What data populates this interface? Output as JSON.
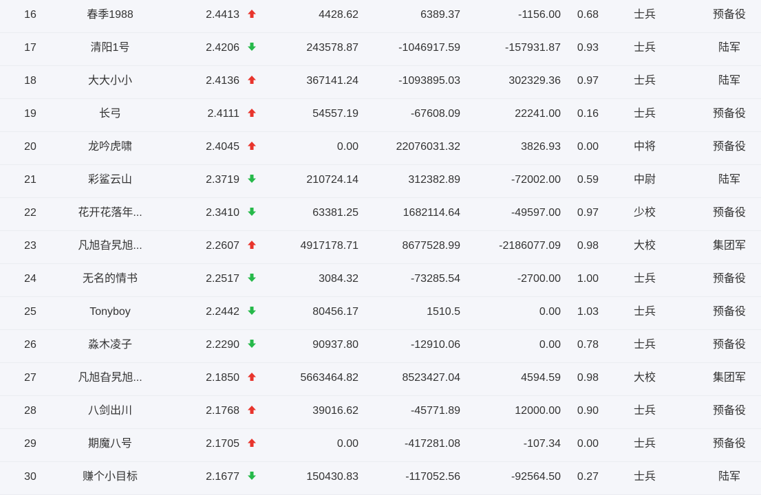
{
  "colors": {
    "up": "#e8342c",
    "down": "#26b94a",
    "text": "#333333",
    "background": "#f5f6fa"
  },
  "rows": [
    {
      "rank": "16",
      "name": "春季1988",
      "score": "2.4413",
      "trend": "up-arrow-icon",
      "v1": "4428.62",
      "v2": "6389.37",
      "v3": "-1156.00",
      "ratio": "0.68",
      "rank_name": "士兵",
      "unit": "预备役"
    },
    {
      "rank": "17",
      "name": "清阳1号",
      "score": "2.4206",
      "trend": "down-arrow-icon",
      "v1": "243578.87",
      "v2": "-1046917.59",
      "v3": "-157931.87",
      "ratio": "0.93",
      "rank_name": "士兵",
      "unit": "陆军"
    },
    {
      "rank": "18",
      "name": "大大小小",
      "score": "2.4136",
      "trend": "up-arrow-icon",
      "v1": "367141.24",
      "v2": "-1093895.03",
      "v3": "302329.36",
      "ratio": "0.97",
      "rank_name": "士兵",
      "unit": "陆军"
    },
    {
      "rank": "19",
      "name": "长弓",
      "score": "2.4111",
      "trend": "up-arrow-icon",
      "v1": "54557.19",
      "v2": "-67608.09",
      "v3": "22241.00",
      "ratio": "0.16",
      "rank_name": "士兵",
      "unit": "预备役"
    },
    {
      "rank": "20",
      "name": "龙吟虎啸",
      "score": "2.4045",
      "trend": "up-arrow-icon",
      "v1": "0.00",
      "v2": "22076031.32",
      "v3": "3826.93",
      "ratio": "0.00",
      "rank_name": "中将",
      "unit": "预备役"
    },
    {
      "rank": "21",
      "name": "彩鲨云山",
      "score": "2.3719",
      "trend": "down-arrow-icon",
      "v1": "210724.14",
      "v2": "312382.89",
      "v3": "-72002.00",
      "ratio": "0.59",
      "rank_name": "中尉",
      "unit": "陆军"
    },
    {
      "rank": "22",
      "name": "花开花落年...",
      "score": "2.3410",
      "trend": "down-arrow-icon",
      "v1": "63381.25",
      "v2": "1682114.64",
      "v3": "-49597.00",
      "ratio": "0.97",
      "rank_name": "少校",
      "unit": "预备役"
    },
    {
      "rank": "23",
      "name": "凡旭旮旯旭...",
      "score": "2.2607",
      "trend": "up-arrow-icon",
      "v1": "4917178.71",
      "v2": "8677528.99",
      "v3": "-2186077.09",
      "ratio": "0.98",
      "rank_name": "大校",
      "unit": "集团军"
    },
    {
      "rank": "24",
      "name": "无名的情书",
      "score": "2.2517",
      "trend": "down-arrow-icon",
      "v1": "3084.32",
      "v2": "-73285.54",
      "v3": "-2700.00",
      "ratio": "1.00",
      "rank_name": "士兵",
      "unit": "预备役"
    },
    {
      "rank": "25",
      "name": "Tonyboy",
      "score": "2.2442",
      "trend": "down-arrow-icon",
      "v1": "80456.17",
      "v2": "1510.5",
      "v3": "0.00",
      "ratio": "1.03",
      "rank_name": "士兵",
      "unit": "预备役"
    },
    {
      "rank": "26",
      "name": "淼木凌子",
      "score": "2.2290",
      "trend": "down-arrow-icon",
      "v1": "90937.80",
      "v2": "-12910.06",
      "v3": "0.00",
      "ratio": "0.78",
      "rank_name": "士兵",
      "unit": "预备役"
    },
    {
      "rank": "27",
      "name": "凡旭旮旯旭...",
      "score": "2.1850",
      "trend": "up-arrow-icon",
      "v1": "5663464.82",
      "v2": "8523427.04",
      "v3": "4594.59",
      "ratio": "0.98",
      "rank_name": "大校",
      "unit": "集团军"
    },
    {
      "rank": "28",
      "name": "八剑出川",
      "score": "2.1768",
      "trend": "up-arrow-icon",
      "v1": "39016.62",
      "v2": "-45771.89",
      "v3": "12000.00",
      "ratio": "0.90",
      "rank_name": "士兵",
      "unit": "预备役"
    },
    {
      "rank": "29",
      "name": "期魔八号",
      "score": "2.1705",
      "trend": "up-arrow-icon",
      "v1": "0.00",
      "v2": "-417281.08",
      "v3": "-107.34",
      "ratio": "0.00",
      "rank_name": "士兵",
      "unit": "预备役"
    },
    {
      "rank": "30",
      "name": "赚个小目标",
      "score": "2.1677",
      "trend": "down-arrow-icon",
      "v1": "150430.83",
      "v2": "-117052.56",
      "v3": "-92564.50",
      "ratio": "0.27",
      "rank_name": "士兵",
      "unit": "陆军"
    }
  ]
}
